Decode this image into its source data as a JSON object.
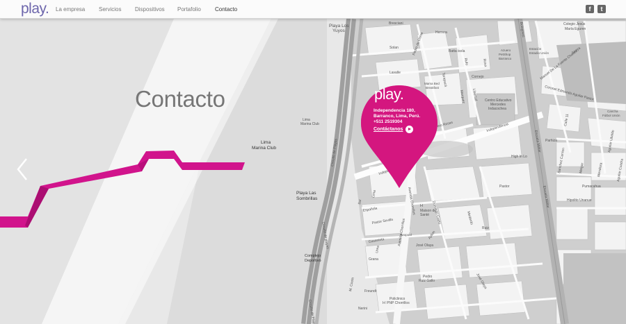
{
  "header": {
    "logo": "play.",
    "nav": [
      {
        "label": "La empresa"
      },
      {
        "label": "Servicios"
      },
      {
        "label": "Dispositivos"
      },
      {
        "label": "Portafolio"
      },
      {
        "label": "Contacto"
      }
    ],
    "social": {
      "facebook": "f",
      "twitter": "t"
    }
  },
  "hero": {
    "title": "Contacto"
  },
  "pin": {
    "logo": "play.",
    "address1": "Independencia 180,",
    "address2": "Barranco, Lima, Perú.",
    "phone": "+511 2519304",
    "cta": "Contáctanos"
  },
  "map_labels": {
    "playa_los_yuyos_1": "Playa Los",
    "playa_los_yuyos_2": "Yuyos",
    "brescianí": "Bresciani",
    "solan": "Solan",
    "pedro_de_osma": "Pedro de Osma",
    "herrera": "Herrera",
    "batta_isola": "Batta isola",
    "tarapaca": "Tarapacá",
    "rufo": "Rufo",
    "rosa": "Rosa",
    "cornejo": "Cornejo",
    "lavalle": "Lavalle",
    "azuero_1": "Azuero",
    "azuero_2": "PetShop",
    "azuero_3": "Barranco",
    "estacion_1": "Estación",
    "estacion_2": "Estadio Unión",
    "bolognesi": "Bolognesi",
    "colegio_1": "Colegio Jesús",
    "colegio_2": "María Eguren",
    "anaya": "Anaya",
    "manuel_fuente": "Manuel De La Fuente Chavez",
    "libertad": "Libertad",
    "marquez": "Marquez",
    "centro_1": "Centro Educativo",
    "centro_2": "Mercedes",
    "centro_3": "Indacochea",
    "coronel": "Coronel Edmundo Aguilar Pastor",
    "calle11": "Calle 11",
    "cancha_1": "Cancha",
    "cancha_2": "Fútbol Unión",
    "aguilar_ubaldo": "Aguilar Ubaldo",
    "parkin_1": "Mama Bed",
    "parkin_2": "Breakfast",
    "barrero_rosas": "Barrero Rosas",
    "independencia_a": "Independencia",
    "independencia_b": "Independencia",
    "pardo": "Parhiza",
    "high_in_lo": "High In Lo",
    "sanchez_carrion": "Sanchez Carrion",
    "melgar": "Melgar",
    "mendoza": "Mendoza",
    "aguilar_cuad": "Aguilar Cuadra",
    "pumacahua": "Pumacahua",
    "hipolito": "Hipolito Unanue",
    "pastor": "Pastor",
    "escuela_militar_a": "Escuela Militar",
    "escuela_militar_b": "Escuela Militar",
    "lima_marina_1": "Lima",
    "lima_marina_2": "Marina Club",
    "lima_marina_big_1": "Lima",
    "lima_marina_big_2": "Marina Club",
    "circuito_a": "Circuito de Playas",
    "circuito_b": "Circuito de playas",
    "circuito_c": "Circuito de Playas",
    "playa_sombrillas_1": "Playa Las",
    "playa_sombrillas_2": "Sombrillas",
    "sur": "Sur",
    "lima_street": "Lima",
    "espanola": "Española",
    "pastor_sevilla": "Pastor Sevilla",
    "avenida_chorrillos_a": "Avenida Chorrillos",
    "avenida_chorrillos_b": "Avenida Chorrillos",
    "maison_1": "Maison de",
    "maison_2": "Santé",
    "maison_h": "H",
    "domingo": "Domingo Cueto",
    "medardo": "Medardo",
    "ayllon": "Ayllon",
    "ruiz": "Ruiz",
    "gasanieta": "Gasanieta",
    "twopool": "Twopool",
    "jose_olaya_a": "José Olaya",
    "jose_olaya_b": "José Olaya",
    "urea": "Urea",
    "grana": "Grana",
    "mcosta": "M. Costa",
    "freundt": "Freundt",
    "nerini": "Nerini",
    "pedro_ruiz_1": "Pedro",
    "pedro_ruiz_2": "Ruiz Gallo",
    "policlinico_h": "H",
    "policlinico_1": "Policlinico",
    "policlinico_2": "PNP Chorrillos",
    "complejo_1": "Complejo",
    "complejo_2": "Deportivo"
  }
}
